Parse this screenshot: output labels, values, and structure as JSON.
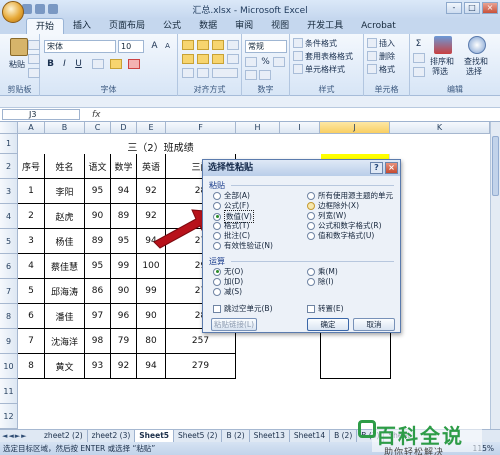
{
  "window": {
    "title": "汇总.xlsx - Microsoft Excel",
    "controls": [
      "-",
      "□",
      "×"
    ]
  },
  "ribbon_tabs": [
    "开始",
    "插入",
    "页面布局",
    "公式",
    "数据",
    "审阅",
    "视图",
    "开发工具",
    "Acrobat"
  ],
  "ribbon": {
    "clipboard": {
      "paste": "粘贴",
      "label": "剪贴板"
    },
    "font": {
      "name": "宋体",
      "size": "10",
      "label": "字体",
      "bold": "B",
      "italic": "I",
      "underline": "U"
    },
    "alignment": {
      "label": "对齐方式"
    },
    "number": {
      "format": "常规",
      "label": "数字",
      "percent": "%"
    },
    "styles": {
      "conditional": "条件格式",
      "table": "套用表格格式",
      "cell": "单元格样式",
      "label": "样式"
    },
    "cells": {
      "insert": "插入",
      "delete": "删除",
      "format": "格式",
      "label": "单元格"
    },
    "editing": {
      "sort": "排序和",
      "filter": "筛选",
      "find": "查找和",
      "select": "选择",
      "label": "编辑"
    }
  },
  "formula_bar": {
    "name_box": "J3",
    "fx": "fx"
  },
  "sheet": {
    "columns": [
      "A",
      "B",
      "C",
      "D",
      "E",
      "F",
      "H",
      "I",
      "J",
      "K"
    ],
    "rows": [
      "1",
      "2",
      "3",
      "4",
      "5",
      "6",
      "7",
      "8",
      "9",
      "10",
      "11",
      "12"
    ],
    "title": "三（2）班成绩",
    "headers": [
      "序号",
      "姓名",
      "语文",
      "数学",
      "英语",
      "三门"
    ],
    "data": [
      [
        "1",
        "李阳",
        "95",
        "94",
        "92",
        "28"
      ],
      [
        "2",
        "赵虎",
        "90",
        "89",
        "92",
        "27"
      ],
      [
        "3",
        "杨佳",
        "89",
        "95",
        "94",
        "27"
      ],
      [
        "4",
        "蔡佳慧",
        "95",
        "99",
        "100",
        "29"
      ],
      [
        "5",
        "邱海涛",
        "86",
        "90",
        "99",
        "27"
      ],
      [
        "6",
        "潘佳",
        "97",
        "96",
        "90",
        "28"
      ],
      [
        "7",
        "沈海洋",
        "98",
        "79",
        "80",
        "257"
      ],
      [
        "8",
        "黄文",
        "93",
        "92",
        "94",
        "279"
      ]
    ],
    "highlight_color": "#ffff00"
  },
  "dialog": {
    "title": "选择性粘贴",
    "help": "?",
    "close": "×",
    "paste_section": "粘贴",
    "paste_options_left": [
      "全部(A)",
      "公式(F)",
      "数值(V)",
      "格式(T)",
      "批注(C)",
      "有效性验证(N)"
    ],
    "paste_options_right": [
      "所有使用源主题的单元",
      "边框除外(X)",
      "列宽(W)",
      "公式和数字格式(R)",
      "值和数字格式(U)"
    ],
    "operation_section": "运算",
    "operation_left": [
      "无(O)",
      "加(D)",
      "减(S)"
    ],
    "operation_right": [
      "乘(M)",
      "除(I)"
    ],
    "skip_blanks": "跳过空单元(B)",
    "transpose": "转置(E)",
    "paste_link": "粘贴链接(L)",
    "ok": "确定",
    "cancel": "取消",
    "selected_paste": 2,
    "selected_operation": 0
  },
  "sheet_tabs": [
    "zheet2 (2)",
    "zheet2 (3)",
    "Sheet5",
    "Sheet5 (2)",
    "B (2)",
    "Sheet13",
    "Sheet14",
    "B (2)",
    "B (3)",
    "Sheet"
  ],
  "active_sheet_tab": 2,
  "status": {
    "text": "选定目标区域，然后按 ENTER 或选择 “粘贴”",
    "zoom": "115%"
  },
  "watermark": {
    "brand": "百科全说",
    "sub": "助你轻松解决"
  },
  "colors": {
    "accent": "#4a78b6",
    "arrow": "#b8121b",
    "brand_green": "#2d9c47"
  }
}
